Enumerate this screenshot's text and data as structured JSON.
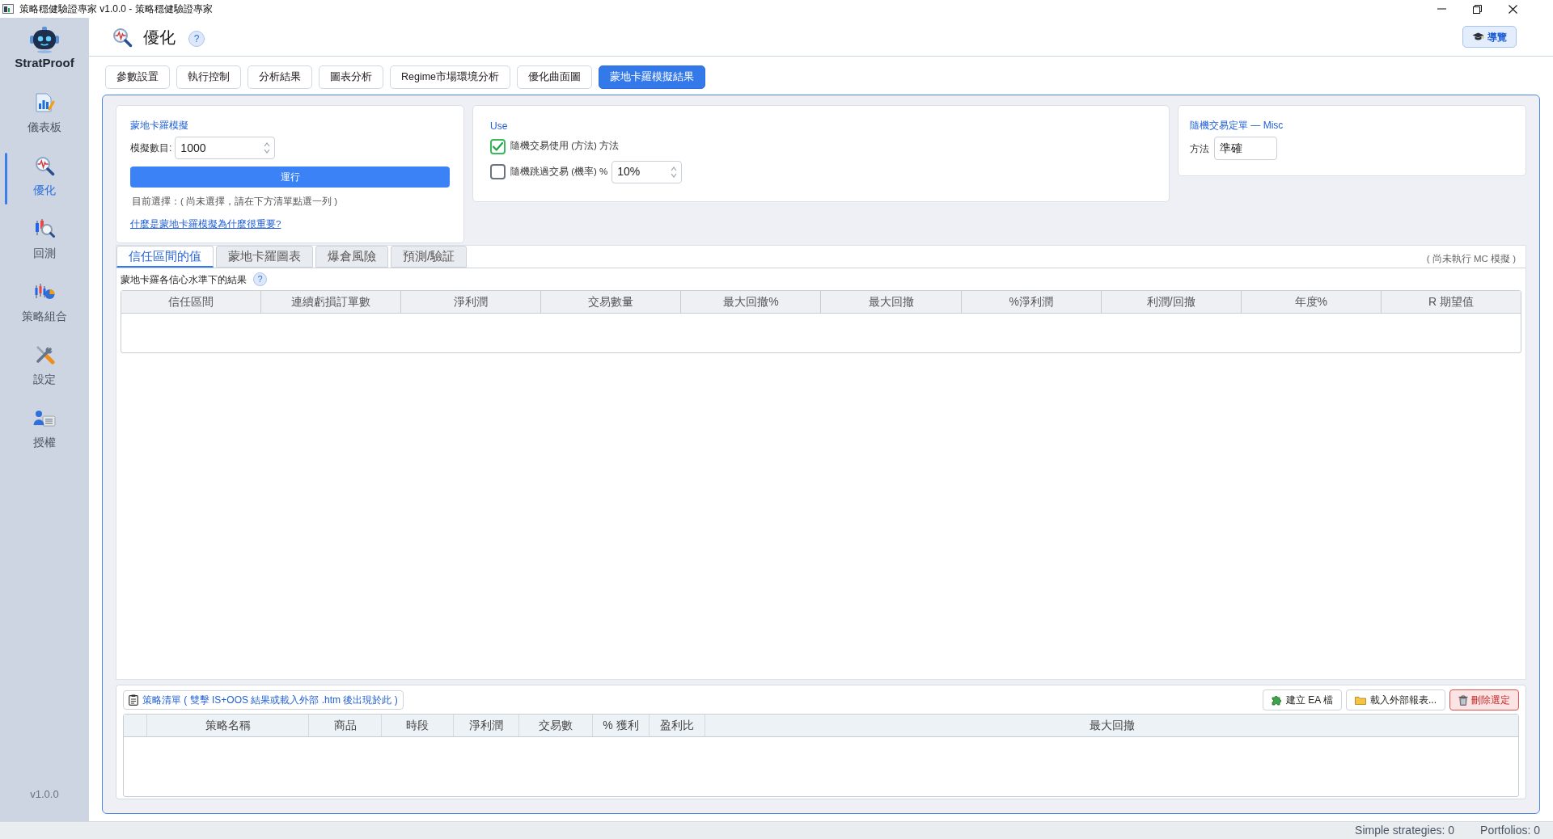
{
  "window": {
    "title": "策略穩健驗證專家 v1.0.0 - 策略穩健驗證專家"
  },
  "sidebar": {
    "brand": "StratProof",
    "items": [
      {
        "label": "儀表板",
        "selected": false
      },
      {
        "label": "優化",
        "selected": true
      },
      {
        "label": "回測",
        "selected": false
      },
      {
        "label": "策略組合",
        "selected": false
      },
      {
        "label": "設定",
        "selected": false
      },
      {
        "label": "授權",
        "selected": false
      }
    ],
    "version": "v1.0.0"
  },
  "header": {
    "title": "優化",
    "help": "?",
    "guide_button": "導覽"
  },
  "tabs": [
    {
      "label": "參數設置",
      "selected": false
    },
    {
      "label": "執行控制",
      "selected": false
    },
    {
      "label": "分析結果",
      "selected": false
    },
    {
      "label": "圖表分析",
      "selected": false
    },
    {
      "label": "Regime市場環境分析",
      "selected": false
    },
    {
      "label": "優化曲面圖",
      "selected": false
    },
    {
      "label": "蒙地卡羅模擬結果",
      "selected": true
    }
  ],
  "monte_carlo": {
    "title": "蒙地卡羅模擬",
    "count_label": "模擬數目:",
    "count_value": "1000",
    "run_button": "運行",
    "selection_note": "目前選擇：( 尚未選擇，請在下方清單點選一列 )",
    "help_link": "什麼是蒙地卡羅模擬為什麼很重要?"
  },
  "use": {
    "title": "Use",
    "options": [
      {
        "kind": "checkbox",
        "label": "隨機交易使用 (方法) 方法",
        "checked": true
      },
      {
        "kind": "checkbox_spin",
        "label": "隨機跳過交易 (機率) %",
        "checked": false,
        "value": "10%"
      }
    ]
  },
  "misc": {
    "title": "隨機交易定單 — Misc",
    "method_label": "方法",
    "method_value": "準確"
  },
  "result_tabs": [
    {
      "label": "信任區間的值",
      "selected": true
    },
    {
      "label": "蒙地卡羅圖表",
      "selected": false
    },
    {
      "label": "爆倉風險",
      "selected": false
    },
    {
      "label": "預測/驗証",
      "selected": false
    }
  ],
  "run_status": "( 尚未執行 MC 模擬 )",
  "results": {
    "caption": "蒙地卡羅各信心水準下的結果",
    "help": "?",
    "table": {
      "columns": [
        "信任區間",
        "連續虧損訂單數",
        "淨利潤",
        "交易數量",
        "最大回撤%",
        "最大回撤",
        "%淨利潤",
        "利潤/回撤",
        "年度%",
        "R 期望值"
      ]
    }
  },
  "strategy_list": {
    "caption": "策略清單 ( 雙擊 IS+OOS 結果或載入外部 .htm 後出現於此 )",
    "buttons": [
      {
        "kind": "create",
        "label": "建立 EA 檔"
      },
      {
        "kind": "load",
        "label": "載入外部報表..."
      },
      {
        "kind": "delete",
        "label": "刪除選定"
      }
    ],
    "table": {
      "columns": [
        "策略名稱",
        "商品",
        "時段",
        "淨利潤",
        "交易數",
        "% 獲利",
        "盈利比",
        "最大回撤"
      ]
    }
  },
  "status_bar": [
    "Simple strategies: 0",
    "Portfolios: 0"
  ]
}
